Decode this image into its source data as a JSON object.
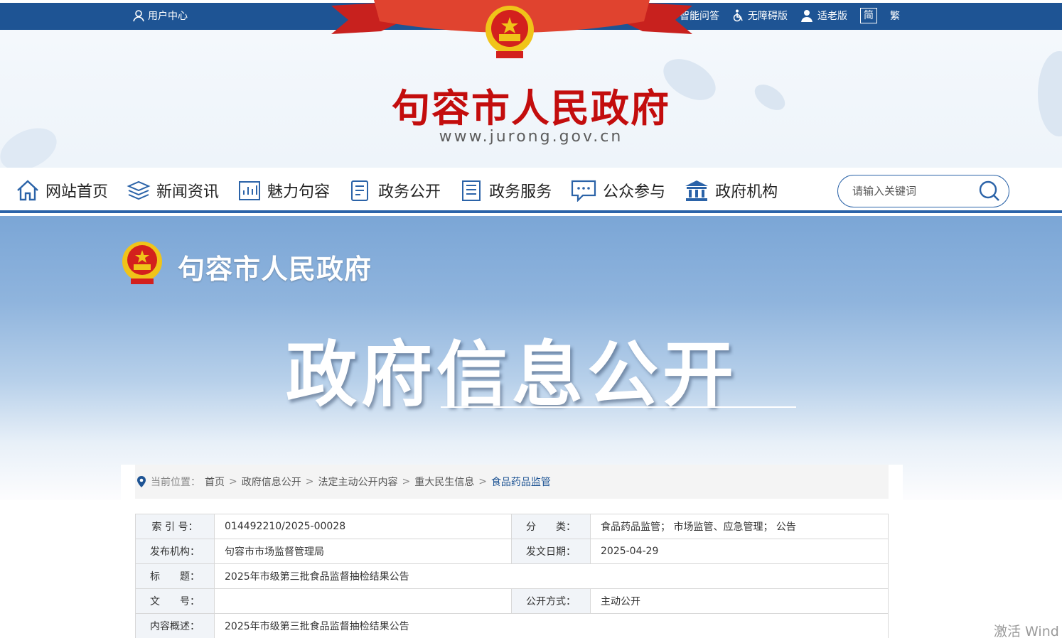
{
  "topbar": {
    "user_center": "用户中心",
    "tools": {
      "qa": "智能问答",
      "accessibility": "无障碍版",
      "elder": "适老版",
      "simplified": "简",
      "traditional": "繁"
    }
  },
  "header": {
    "title": "句容市人民政府",
    "url": "www.jurong.gov.cn"
  },
  "nav": {
    "items": [
      "网站首页",
      "新闻资讯",
      "魅力句容",
      "政务公开",
      "政务服务",
      "公众参与",
      "政府机构"
    ],
    "search_placeholder": "请输入关键词"
  },
  "banner": {
    "gov_name": "句容市人民政府",
    "title": "政府信息公开"
  },
  "breadcrumb": {
    "label": "当前位置：",
    "items": [
      "首页",
      "政府信息公开",
      "法定主动公开内容",
      "重大民生信息",
      "食品药品监管"
    ],
    "separator": ">"
  },
  "meta": {
    "index_label": "索 引 号：",
    "index_value": "014492210/2025-00028",
    "category_label": "分　　类：",
    "category_value": "食品药品监管； 市场监管、应急管理； 公告",
    "org_label": "发布机构：",
    "org_value": "句容市市场监督管理局",
    "date_label": "发文日期：",
    "date_value": "2025-04-29",
    "title_label": "标　　题：",
    "title_value": "2025年市级第三批食品监督抽检结果公告",
    "doc_label": "文　　号：",
    "doc_value": "",
    "mode_label": "公开方式：",
    "mode_value": "主动公开",
    "summary_label": "内容概述：",
    "summary_value": "2025年市级第三批食品监督抽检结果公告"
  },
  "watermark": "激活 Wind",
  "colors": {
    "primary": "#1e5494",
    "title_red": "#c30d0d",
    "nav_border": "#2b63a8"
  }
}
